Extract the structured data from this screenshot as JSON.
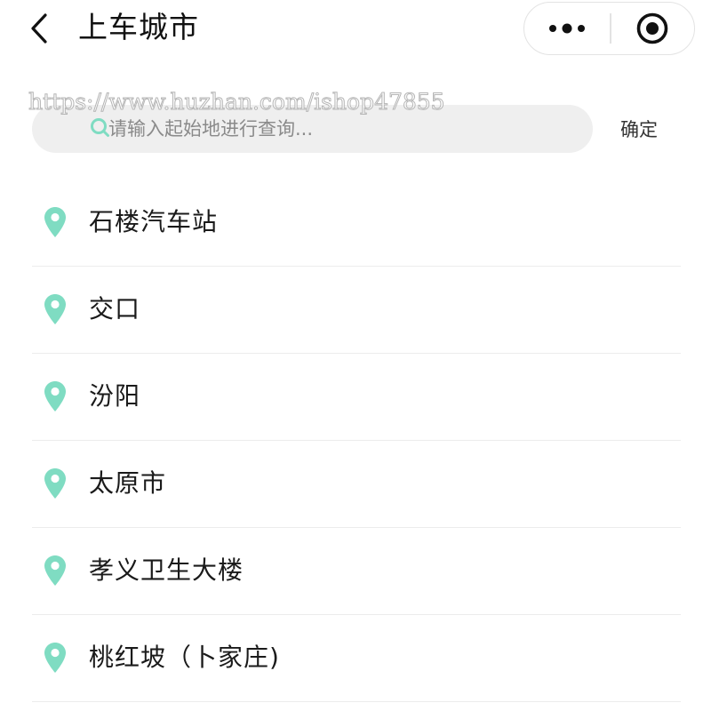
{
  "header": {
    "title": "上车城市",
    "back_icon": "chevron-left-icon",
    "more_icon": "more-dots-icon",
    "close_icon": "target-close-icon"
  },
  "watermark": "https://www.huzhan.com/ishop47855",
  "search": {
    "placeholder": "请输入起始地进行查询...",
    "value": "",
    "icon": "search-icon",
    "confirm_label": "确定"
  },
  "cities": [
    {
      "label": "石楼汽车站"
    },
    {
      "label": "交口"
    },
    {
      "label": "汾阳"
    },
    {
      "label": "太原市"
    },
    {
      "label": "孝义卫生大楼"
    },
    {
      "label": "桃红坡（卜家庄)"
    }
  ],
  "colors": {
    "accent": "#7fdcc2",
    "search_bg": "#efefef",
    "divider": "#ececec",
    "text": "#1a1a1a"
  }
}
